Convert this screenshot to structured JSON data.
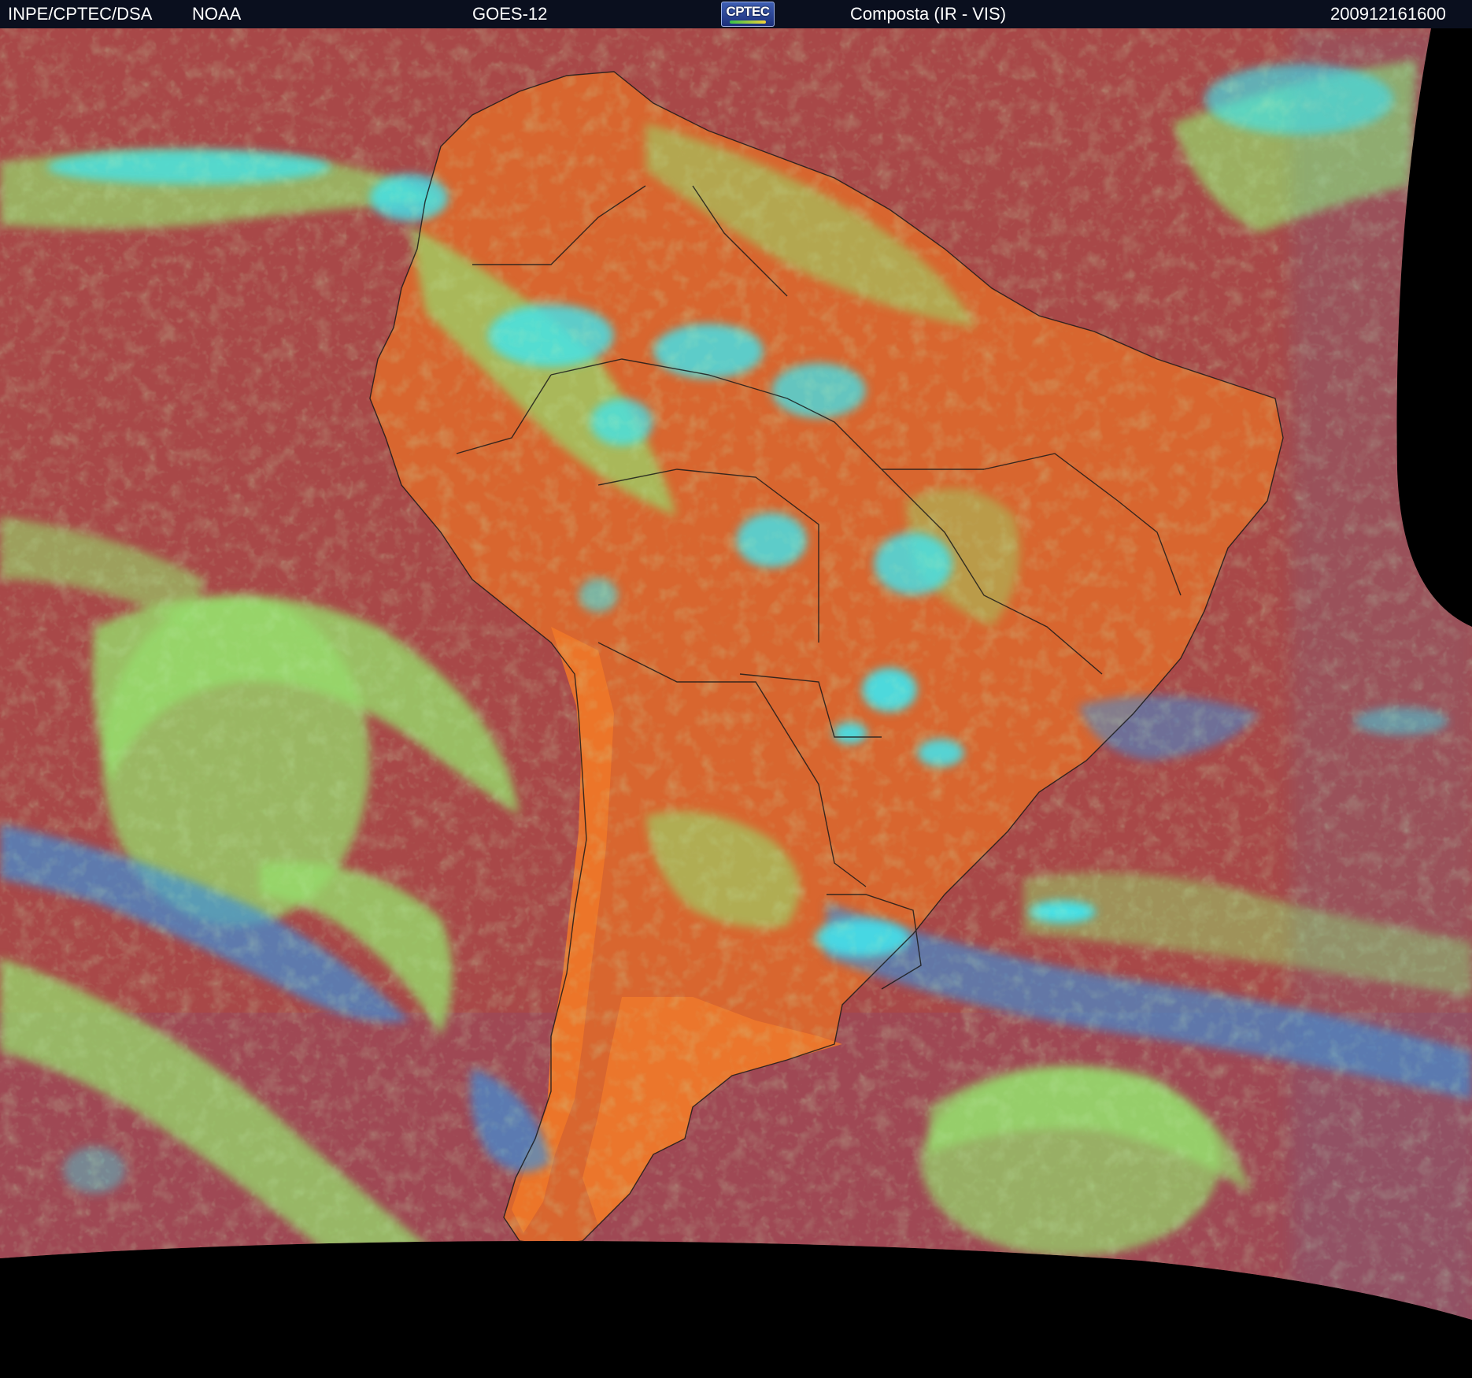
{
  "header": {
    "agency": "INPE/CPTEC/DSA",
    "partner": "NOAA",
    "satellite": "GOES-12",
    "logo_text": "CPTEC",
    "product": "Composta (IR - VIS)",
    "timestamp": "200912161600"
  },
  "colors": {
    "header_background": "#0a0f1e",
    "header_text": "#ffffff",
    "ocean_clear": "#a84848",
    "land_clear": "#d8662f",
    "low_cloud": "#96dc6c",
    "high_cloud": "#3ee6f0",
    "mid_cloud": "#3e90d8",
    "off_disk": "#000000",
    "borders": "#1a1a1a"
  },
  "icons": {
    "logo": "cptec-logo"
  }
}
